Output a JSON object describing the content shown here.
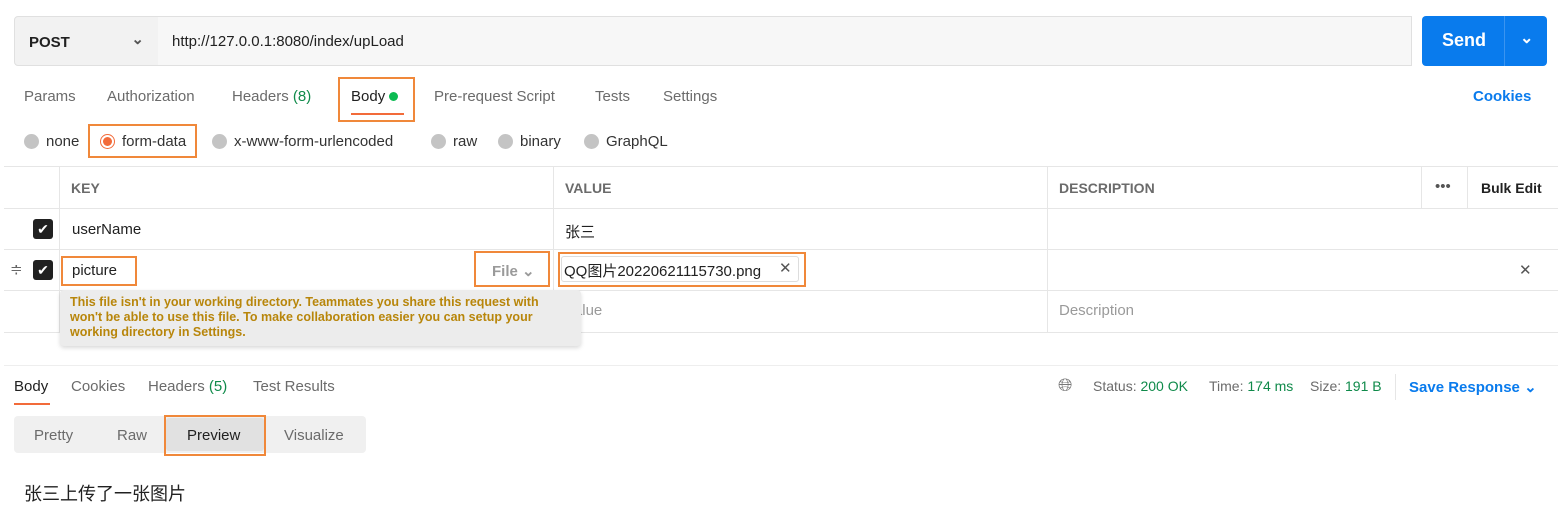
{
  "request": {
    "method": "POST",
    "url": "http://127.0.0.1:8080/index/upLoad",
    "send": "Send"
  },
  "tabs": [
    {
      "label": "Params"
    },
    {
      "label": "Authorization"
    },
    {
      "label": "Headers",
      "count": "(8)"
    },
    {
      "label": "Body"
    },
    {
      "label": "Pre-request Script"
    },
    {
      "label": "Tests"
    },
    {
      "label": "Settings"
    }
  ],
  "cookies": "Cookies",
  "body_types": [
    "none",
    "form-data",
    "x-www-form-urlencoded",
    "raw",
    "binary",
    "GraphQL"
  ],
  "table": {
    "headers": [
      "KEY",
      "VALUE",
      "DESCRIPTION"
    ],
    "bulk_edit": "Bulk Edit",
    "rows": [
      {
        "key": "userName",
        "value": "张三"
      },
      {
        "key": "picture",
        "type": "File",
        "value": "QQ图片20220621115730.png"
      }
    ],
    "placeholder_value": "Value",
    "placeholder_description": "Description"
  },
  "tooltip": "This file isn't in your working directory. Teammates you share this request with won't be able to use this file. To make collaboration easier you can setup your working directory in Settings.",
  "response": {
    "tabs": [
      {
        "label": "Body"
      },
      {
        "label": "Cookies"
      },
      {
        "label": "Headers",
        "count": "(5)"
      },
      {
        "label": "Test Results"
      }
    ],
    "status_label": "Status:",
    "status": "200 OK",
    "time_label": "Time:",
    "time": "174 ms",
    "size_label": "Size:",
    "size": "191 B",
    "save": "Save Response",
    "views": [
      "Pretty",
      "Raw",
      "Preview",
      "Visualize"
    ],
    "content": "张三上传了一张图片"
  },
  "colors": {
    "accent": "#097bed",
    "highlight": "#f0883a",
    "active_tab": "#f26b3a",
    "success": "#0f8a4a"
  }
}
